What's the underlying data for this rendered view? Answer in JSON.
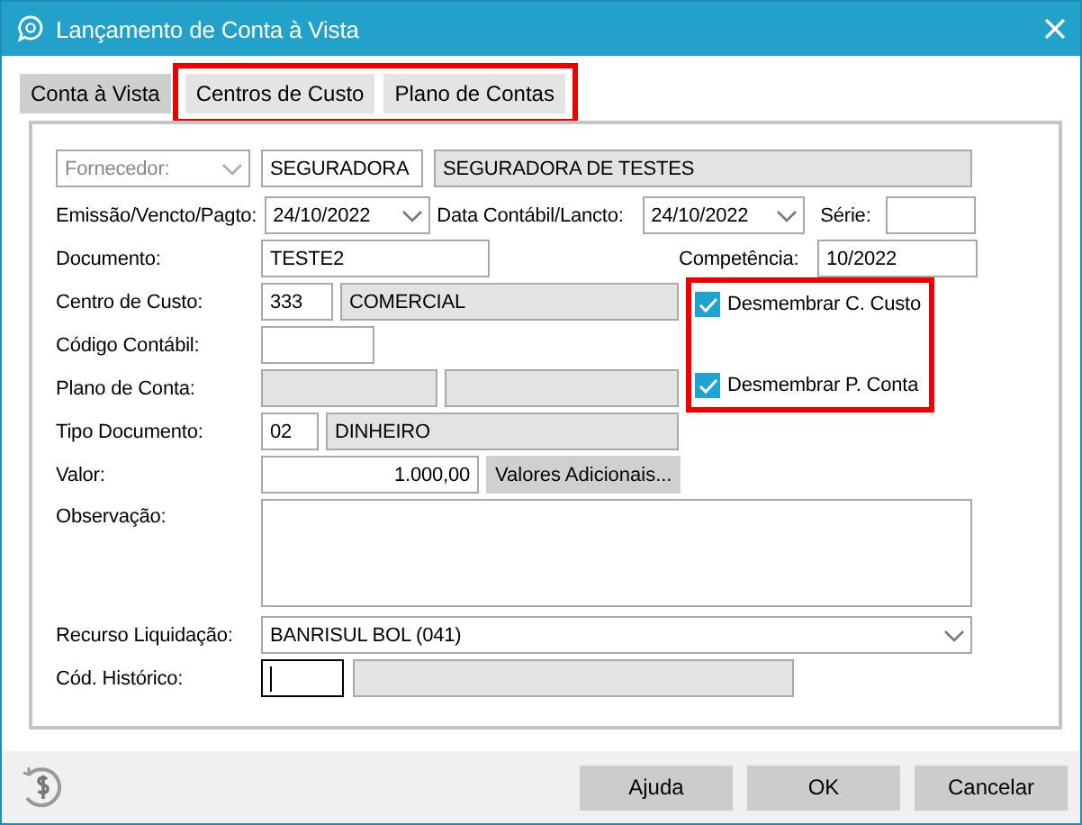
{
  "window": {
    "title": "Lançamento de Conta à Vista"
  },
  "tabs": [
    {
      "label": "Conta à Vista",
      "selected": true
    },
    {
      "label": "Centros de Custo",
      "selected": false
    },
    {
      "label": "Plano de Contas",
      "selected": false
    }
  ],
  "tabs_highlighted": true,
  "supplier": {
    "label": "Fornecedor:",
    "disabled": true,
    "code": "SEGURADORA",
    "name": "SEGURADORA DE TESTES"
  },
  "issue_date": {
    "label": "Emissão/Vencto/Pagto:",
    "value": "24/10/2022"
  },
  "accounting_date": {
    "label": "Data Contábil/Lancto:",
    "value": "24/10/2022"
  },
  "series": {
    "label": "Série:"
  },
  "document": {
    "label": "Documento:",
    "value": "TESTE2"
  },
  "competence": {
    "label": "Competência:",
    "value": "10/2022"
  },
  "cost_center": {
    "label": "Centro de Custo:",
    "code": "333",
    "name": "COMERCIAL"
  },
  "accounting_code": {
    "label": "Código Contábil:"
  },
  "account_plan": {
    "label": "Plano de Conta:"
  },
  "document_type": {
    "label": "Tipo Documento:",
    "code": "02",
    "name": "DINHEIRO"
  },
  "amount": {
    "label": "Valor:",
    "value": "1.000,00",
    "button": "Valores Adicionais..."
  },
  "note": {
    "label": "Observação:"
  },
  "settlement": {
    "label": "Recurso Liquidação:",
    "value": "BANRISUL BOL (041)"
  },
  "history": {
    "label": "Cód. Histórico:",
    "focused": true
  },
  "checkboxes": {
    "highlighted": true,
    "items": [
      {
        "label": "Desmembrar C. Custo",
        "checked": true
      },
      {
        "label": "Desmembrar P. Conta",
        "checked": true
      }
    ]
  },
  "buttons": [
    "Ajuda",
    "OK",
    "Cancelar"
  ]
}
